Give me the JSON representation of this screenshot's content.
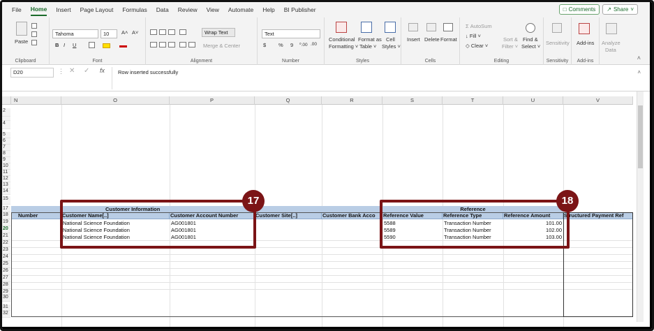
{
  "ribbon_tabs": [
    "File",
    "Home",
    "Insert",
    "Page Layout",
    "Formulas",
    "Data",
    "Review",
    "View",
    "Automate",
    "Help",
    "BI Publisher"
  ],
  "active_tab": "Home",
  "comments_label": "Comments",
  "share_label": "Share",
  "clipboard": {
    "paste": "Paste",
    "label": "Clipboard"
  },
  "font": {
    "name": "Tahoma",
    "size": "10",
    "label": "Font",
    "bold": "B",
    "italic": "I",
    "underline": "U",
    "grow": "A˄",
    "shrink": "A˅"
  },
  "alignment": {
    "wrap": "Wrap Text",
    "merge": "Merge & Center",
    "label": "Alignment"
  },
  "number": {
    "format": "Text",
    "currency": "$",
    "percent": "%",
    "comma": "9",
    "inc": "⁰.00",
    "dec": ".00",
    "label": "Number"
  },
  "styles": {
    "conditional": "Conditional",
    "formatting": "Formatting ˅",
    "format_as": "Format as",
    "table": "Table ˅",
    "cell": "Cell",
    "cell_styles": "Styles ˅",
    "label": "Styles"
  },
  "cells": {
    "insert": "Insert",
    "delete": "Delete",
    "format": "Format",
    "label": "Cells"
  },
  "editing": {
    "autosum": "AutoSum",
    "fill": "Fill ˅",
    "clear": "Clear ˅",
    "sort": "Sort &",
    "filter": "Filter ˅",
    "find": "Find &",
    "select": "Select ˅",
    "label": "Editing"
  },
  "sensitivity": {
    "name": "Sensitivity",
    "label": "Sensitivity"
  },
  "addins": {
    "name": "Add-ins",
    "label": "Add-ins",
    "analyze": "Analyze",
    "data": "Data"
  },
  "formula_bar": {
    "name_box": "D20",
    "fx": "fx",
    "value": "Row inserted successfully"
  },
  "columns": [
    "N",
    "O",
    "P",
    "Q",
    "R",
    "S",
    "T",
    "U",
    "V"
  ],
  "rows_top": [
    "2",
    "",
    "4",
    "5",
    "6",
    "7",
    "8",
    "9",
    "10",
    "11",
    "12",
    "13",
    "14"
  ],
  "rows_bottom": [
    "15",
    "17",
    "18",
    "19",
    "20",
    "21",
    "22",
    "23",
    "24",
    "25",
    "26",
    "27",
    "28",
    "29",
    "30",
    "31",
    "32"
  ],
  "group_headers": {
    "customer": "Customer Information",
    "reference": "Reference"
  },
  "table_headers": [
    "Number",
    "Customer Name[..]",
    "Customer Account Number",
    "Customer Site[..]",
    "Customer Bank Acco",
    "Reference Value",
    "Reference Type",
    "Reference Amount",
    "Structured Payment Ref"
  ],
  "rows": [
    {
      "name": "National Science Foundation",
      "account": "AG001801",
      "ref_value": "5588",
      "ref_type": "Transaction Number",
      "amount": "101.00"
    },
    {
      "name": "National Science Foundation",
      "account": "AG001801",
      "ref_value": "5589",
      "ref_type": "Transaction Number",
      "amount": "102.00"
    },
    {
      "name": "National Science Foundation",
      "account": "AG001801",
      "ref_value": "5590",
      "ref_type": "Transaction Number",
      "amount": "103.00"
    }
  ],
  "callouts": [
    "17",
    "18"
  ],
  "colors": {
    "accent": "#1a6b2b",
    "callout": "#7b1416",
    "header_fill": "#b9cde5"
  }
}
